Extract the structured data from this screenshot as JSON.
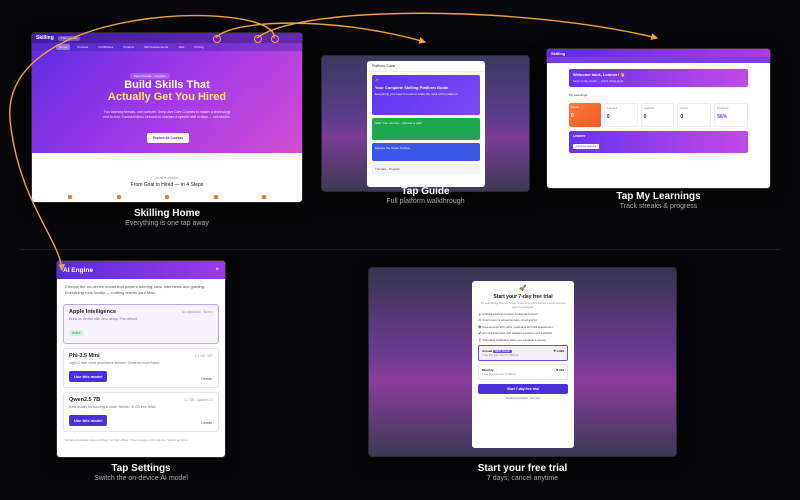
{
  "captions": {
    "home": {
      "title": "Skilling Home",
      "sub": "Everything is one tap away"
    },
    "guide": {
      "title": "Tap Guide",
      "sub": "Full platform walkthrough"
    },
    "learn": {
      "title": "Tap My Learnings",
      "sub": "Track streaks & progress"
    },
    "settings": {
      "title": "Tap Settings",
      "sub": "Switch the on-device AI model"
    },
    "trial": {
      "title": "Start your free trial",
      "sub": "7 days, cancel anytime"
    }
  },
  "home": {
    "logo": "Skilling",
    "nav_chip": "Start for free",
    "tabs": [
      "Home",
      "Courses",
      "Certificates",
      "Projects",
      "Skill Assessments",
      "Jobs",
      "Pricing"
    ],
    "pill": "Most Popular · Courses",
    "headline_1": "Build Skills That",
    "headline_2": "Actually Get You Hired",
    "lead": "Two learning formats, one platform. Deep-dive Core Courses to master a technology end-to-end. Focused Micro Lessons to sharpen a specific skill in days — not months.",
    "cta": "Explore All Courses",
    "goal_small": "HOW IT WORKS",
    "goal": "From Goal to Hired — in 4 Steps"
  },
  "guide": {
    "header": "Platform Guide",
    "card1_title": "Your Complete Skilling Platform Guide",
    "card1_text": "Everything you need to know to make the most of the platform.",
    "card2_text": "Start Your Journey · Choose a path",
    "card3_text": "Explore the Smart Toolbox",
    "card4_text": "Tutorials · Projects"
  },
  "learn": {
    "logo": "Skilling",
    "welcome": "Welcome back, Learner! 👋",
    "welcome_sub": "Keep up the streak — you're doing great.",
    "my_label": "My Learnings",
    "stats": [
      {
        "label": "Streak",
        "value": "0"
      },
      {
        "label": "Courses",
        "value": "0"
      },
      {
        "label": "Lessons",
        "value": "0"
      },
      {
        "label": "Hours",
        "value": "0"
      },
      {
        "label": "Progress",
        "value": "56%"
      }
    ],
    "banner_title": "Learner",
    "banner_btn": "Continue learning"
  },
  "settings": {
    "title": "AI Engine",
    "close": "×",
    "intro": "Choose the on-device model that powers tutoring, labs, interviews and grading. Everything runs locally — nothing leaves your Mac.",
    "models": [
      {
        "name": "Apple Intelligence",
        "tag": "Active",
        "meta": "No download · Built in",
        "desc": "Runs on device with zero setup. The default.",
        "active_label": "Active",
        "button": ""
      },
      {
        "name": "Phi-3.5 Mini",
        "tag": "",
        "meta": "2.4 GB · MIT",
        "desc": "Light & fast; most permissive license. Great for most Macs.",
        "active_label": "",
        "button": "Use this model",
        "secondary": "Details"
      },
      {
        "name": "Qwen2.5 7B",
        "tag": "",
        "meta": "4.7 GB · Apache 2.0",
        "desc": "Best quality for tutoring & code. Needs ~8 GB free RAM.",
        "active_label": "",
        "button": "Use this model",
        "secondary": "Details"
      }
    ],
    "footer": "Models download once and then run fully offline. They're kept on this device. Switch anytime."
  },
  "trial": {
    "title": "Start your 7-day free trial",
    "desc": "Try everything free for 7 days. Cancel anytime before it ends and you won't be charged.",
    "features": [
      "Unlimited access to every course and lesson",
      "Smart tutors & lab across labs, cloud and AI",
      "Assessments with paths, roadmaps and skill assessment",
      "AI mock interviews with detailed questions and feedback",
      "Shareable certificates when you complete a course"
    ],
    "plans": [
      {
        "name": "Annual",
        "badge": "BEST VALUE",
        "price": "₹ 1,999",
        "sub": "7-day free trial, then ₹ 1,999/year"
      },
      {
        "name": "Monthly",
        "badge": "",
        "price": "₹ 199",
        "sub": "7-day free trial, then ₹ 199/mo"
      }
    ],
    "start": "Start 7-day free trial",
    "links": "Restore purchases · Not now"
  },
  "colors": {
    "accent": "#5a2be0",
    "highlight": "#f0a33a",
    "yellow": "#ffe26a"
  }
}
